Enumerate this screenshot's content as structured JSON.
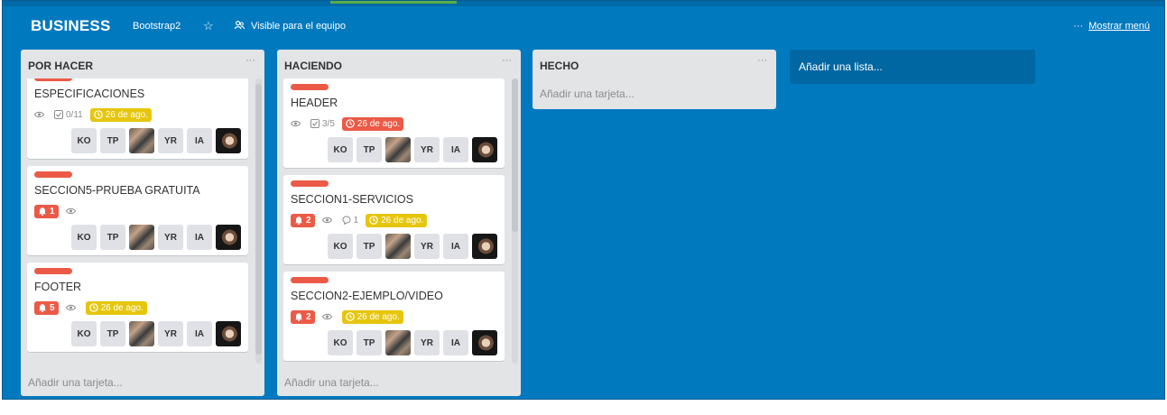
{
  "board": {
    "title": "BUSINESS",
    "team": "Bootstrap2",
    "visibility": "Visible para el equipo",
    "menu_dots": "···",
    "menu_label": "Mostrar menú",
    "background_color": "#0079bf"
  },
  "lists": [
    {
      "title": "POR HACER",
      "more": "···",
      "add_card": "Añadir una tarjeta...",
      "cards": [
        {
          "has_label": true,
          "title": "ESPECIFICACIONES",
          "eye": true,
          "notifications": "",
          "comments": "",
          "checklist": "0/11",
          "due": "26 de ago.",
          "due_overdue": false,
          "members": [
            "KO",
            "TP",
            "",
            "YR",
            "IA",
            ""
          ]
        },
        {
          "has_label": true,
          "title": "SECCION5-PRUEBA GRATUITA",
          "eye": true,
          "notifications": "1",
          "comments": "",
          "checklist": "",
          "due": "",
          "due_overdue": false,
          "members": [
            "KO",
            "TP",
            "",
            "YR",
            "IA",
            ""
          ]
        },
        {
          "has_label": true,
          "title": "FOOTER",
          "eye": true,
          "notifications": "5",
          "comments": "",
          "checklist": "",
          "due": "26 de ago.",
          "due_overdue": false,
          "members": [
            "KO",
            "TP",
            "",
            "YR",
            "IA",
            ""
          ]
        }
      ]
    },
    {
      "title": "HACIENDO",
      "more": "···",
      "add_card": "Añadir una tarjeta...",
      "cards": [
        {
          "has_label": true,
          "title": "HEADER",
          "eye": true,
          "notifications": "",
          "comments": "",
          "checklist": "3/5",
          "due": "26 de ago.",
          "due_overdue": true,
          "members": [
            "KO",
            "TP",
            "",
            "YR",
            "IA",
            ""
          ]
        },
        {
          "has_label": true,
          "title": "SECCION1-SERVICIOS",
          "eye": true,
          "notifications": "2",
          "comments": "1",
          "checklist": "",
          "due": "26 de ago.",
          "due_overdue": false,
          "members": [
            "KO",
            "TP",
            "",
            "YR",
            "IA",
            ""
          ]
        },
        {
          "has_label": true,
          "title": "SECCION2-EJEMPLO/VIDEO",
          "eye": true,
          "notifications": "2",
          "comments": "",
          "checklist": "",
          "due": "26 de ago.",
          "due_overdue": false,
          "members": [
            "KO",
            "TP",
            "",
            "YR",
            "IA",
            ""
          ]
        }
      ]
    },
    {
      "title": "HECHO",
      "more": "···",
      "add_card": "Añadir una tarjeta...",
      "cards": []
    }
  ],
  "add_list": "Añadir una lista...",
  "colors": {
    "label_red": "#eb5a46",
    "due_yellow": "#e6c60d",
    "list_bg": "#e2e4e6"
  },
  "icons": {
    "star": "star-icon",
    "visibility": "team-icon",
    "eye": "eye-icon",
    "checklist": "checklist-icon",
    "clock": "clock-icon",
    "bell": "bell-icon",
    "comment": "comment-icon"
  }
}
